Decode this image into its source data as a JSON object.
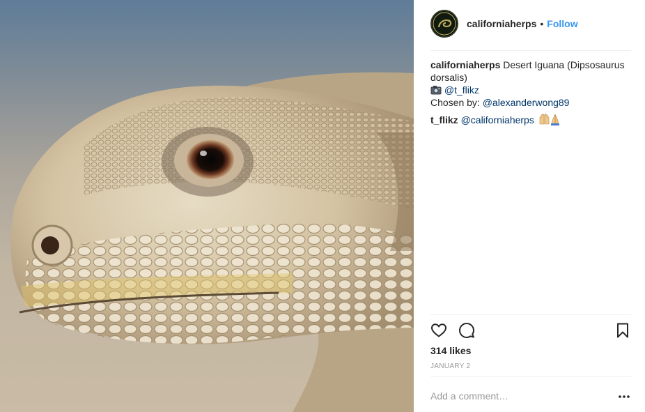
{
  "post": {
    "photo_alt": "",
    "header": {
      "username": "californiaherps",
      "separator": "•",
      "follow_label": "Follow"
    },
    "caption": {
      "username": "californiaherps",
      "text": "Desert Iguana (Dipsosaurus dorsalis)",
      "camera_icon": "camera-icon",
      "credit_handle": "@t_flikz",
      "chosen_by_label": "Chosen by:",
      "chosen_by_handle": "@alexanderwong89"
    },
    "comments": [
      {
        "username": "t_flikz",
        "mention": "@californiaherps",
        "emoji": "raised-hands-and-praying-hands-emoji"
      }
    ],
    "actions": {
      "like_icon": "heart-icon",
      "comment_icon": "speech-bubble-icon",
      "save_icon": "bookmark-icon"
    },
    "likes_text": "314 likes",
    "date_text": "JANUARY 2",
    "add_comment_placeholder": "Add a comment…",
    "more_icon": "ellipsis-icon",
    "colors": {
      "follow_blue": "#3897f0",
      "link_navy": "#003569",
      "muted_gray": "#999999",
      "text": "#262626"
    }
  }
}
